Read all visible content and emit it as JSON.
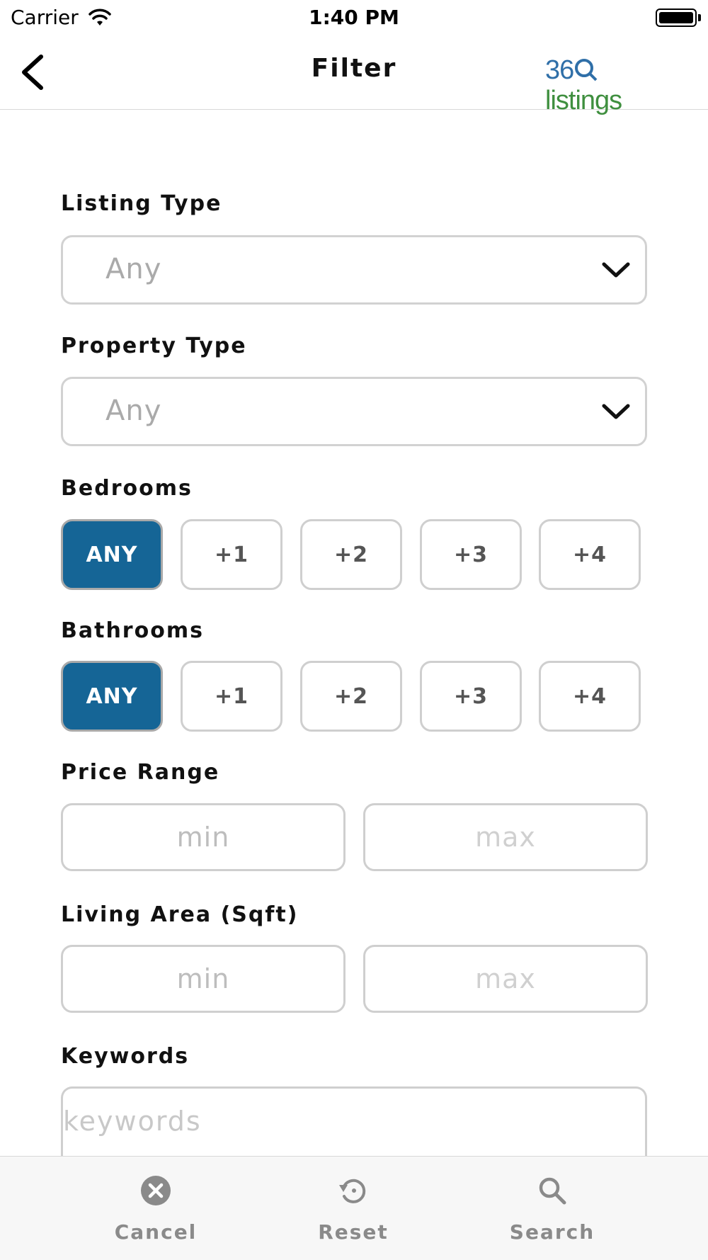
{
  "status_bar": {
    "carrier": "Carrier",
    "time": "1:40 PM"
  },
  "nav": {
    "title": "Filter",
    "logo_text_blue": "36",
    "logo_text_green": "listings"
  },
  "listing_type": {
    "label": "Listing Type",
    "value": "Any"
  },
  "property_type": {
    "label": "Property Type",
    "value": "Any"
  },
  "bedrooms": {
    "label": "Bedrooms",
    "options": [
      "ANY",
      "+1",
      "+2",
      "+3",
      "+4"
    ],
    "selected": "ANY"
  },
  "bathrooms": {
    "label": "Bathrooms",
    "options": [
      "ANY",
      "+1",
      "+2",
      "+3",
      "+4"
    ],
    "selected": "ANY"
  },
  "price_range": {
    "label": "Price Range",
    "min_placeholder": "min",
    "max_placeholder": "max"
  },
  "living_area": {
    "label": "Living Area (Sqft)",
    "min_placeholder": "min",
    "max_placeholder": "max"
  },
  "keywords": {
    "label": "Keywords",
    "placeholder": "keywords"
  },
  "tab_bar": {
    "cancel": "Cancel",
    "reset": "Reset",
    "search": "Search"
  },
  "colors": {
    "accent": "#156596",
    "logo_blue": "#2f6fa8",
    "logo_green": "#3f8f3f"
  }
}
